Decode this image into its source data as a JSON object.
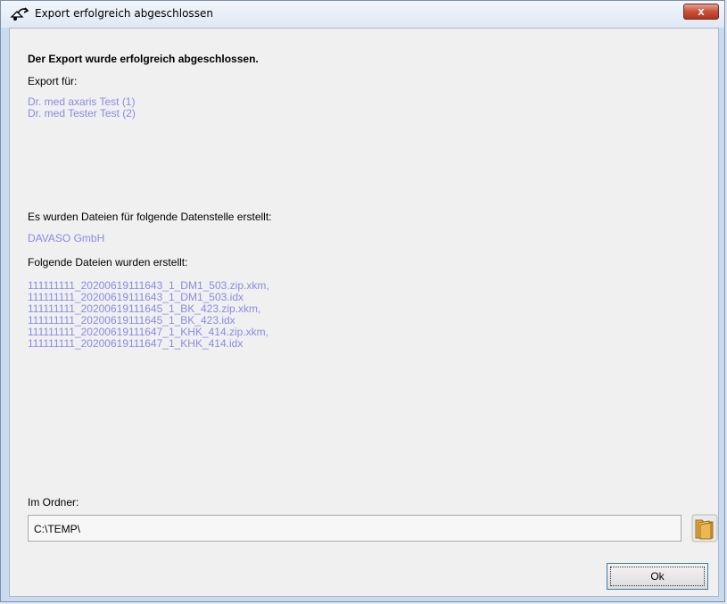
{
  "window": {
    "title": "Export erfolgreich abgeschlossen",
    "close_label": "x"
  },
  "dialog": {
    "heading": "Der Export wurde erfolgreich abgeschlossen.",
    "export_for_label": "Export für:",
    "export_for": [
      "Dr. med axaris Test (1)",
      "Dr. med Tester Test (2)"
    ],
    "datastelle_label": "Es wurden Dateien für folgende Datenstelle erstellt:",
    "datastelle": "DAVASO GmbH",
    "files_label": "Folgende Dateien wurden erstellt:",
    "files": [
      "111111111_20200619111643_1_DM1_503.zip.xkm,",
      "111111111_20200619111643_1_DM1_503.idx",
      "111111111_20200619111645_1_BK_423.zip.xkm,",
      "111111111_20200619111645_1_BK_423.idx",
      "111111111_20200619111647_1_KHK_414.zip.xkm,",
      "111111111_20200619111647_1_KHK_414.idx"
    ],
    "folder_label": "Im Ordner:",
    "folder_value": "C:\\TEMP\\",
    "ok_label": "Ok"
  },
  "colors": {
    "link": "#8a8ae6",
    "close_button": "#c7513a"
  },
  "icons": {
    "title": "export-icon",
    "folder": "folder-icon"
  }
}
